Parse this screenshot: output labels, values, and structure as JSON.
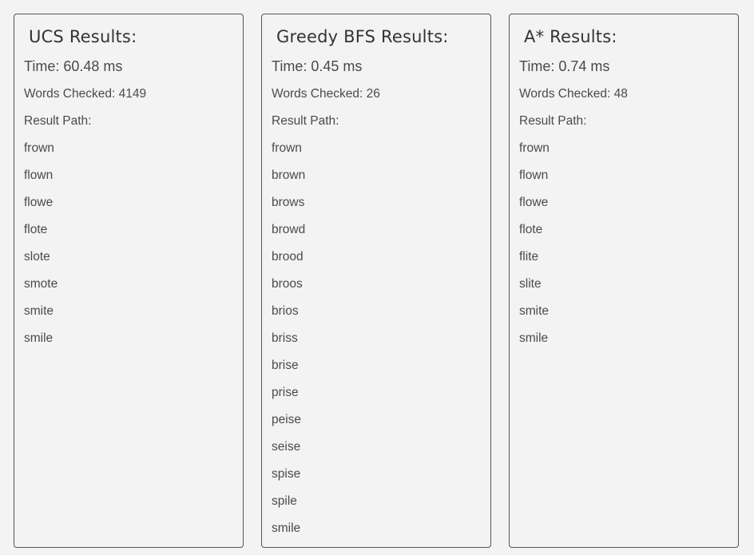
{
  "panels": [
    {
      "title": "UCS Results:",
      "time_label": "Time:",
      "time_value": "60.48 ms",
      "words_label": "Words Checked:",
      "words_value": "4149",
      "path_label": "Result Path:",
      "path": [
        "frown",
        "flown",
        "flowe",
        "flote",
        "slote",
        "smote",
        "smite",
        "smile"
      ]
    },
    {
      "title": "Greedy BFS Results:",
      "time_label": "Time:",
      "time_value": "0.45 ms",
      "words_label": "Words Checked:",
      "words_value": "26",
      "path_label": "Result Path:",
      "path": [
        "frown",
        "brown",
        "brows",
        "browd",
        "brood",
        "broos",
        "brios",
        "briss",
        "brise",
        "prise",
        "peise",
        "seise",
        "spise",
        "spile",
        "smile"
      ]
    },
    {
      "title": "A* Results:",
      "time_label": "Time:",
      "time_value": "0.74 ms",
      "words_label": "Words Checked:",
      "words_value": "48",
      "path_label": "Result Path:",
      "path": [
        "frown",
        "flown",
        "flowe",
        "flote",
        "flite",
        "slite",
        "smite",
        "smile"
      ]
    }
  ]
}
